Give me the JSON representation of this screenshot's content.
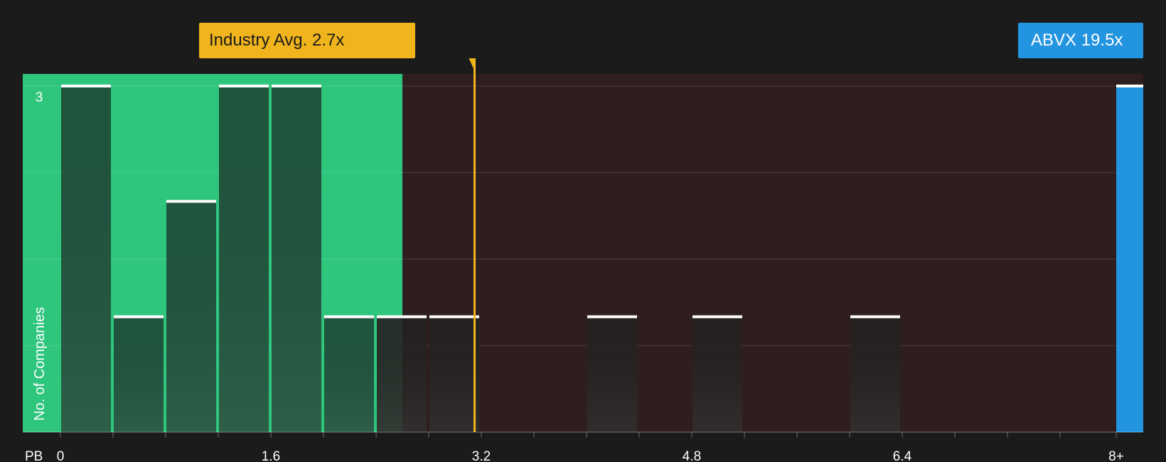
{
  "chart_data": {
    "type": "bar",
    "xlabel": "PB",
    "ylabel": "No. of Companies",
    "x_ticks": [
      "0",
      "1.6",
      "3.2",
      "4.8",
      "6.4",
      "8+"
    ],
    "y_tick_labels": [
      "3"
    ],
    "ylim": [
      0,
      3
    ],
    "bin_width": 0.4,
    "bins": [
      {
        "start": 0.0,
        "count": 3
      },
      {
        "start": 0.4,
        "count": 1
      },
      {
        "start": 0.8,
        "count": 2
      },
      {
        "start": 1.2,
        "count": 3
      },
      {
        "start": 1.6,
        "count": 3
      },
      {
        "start": 2.0,
        "count": 1
      },
      {
        "start": 2.4,
        "count": 1
      },
      {
        "start": 2.8,
        "count": 1
      },
      {
        "start": 4.0,
        "count": 1
      },
      {
        "start": 4.8,
        "count": 1
      },
      {
        "start": 6.0,
        "count": 1
      },
      {
        "start": 8.0,
        "count": 3,
        "label": "8+"
      }
    ],
    "industry_avg": {
      "label": "Industry Avg. 2.7x",
      "value": 2.7
    },
    "company": {
      "label": "ABVX 19.5x",
      "value": 19.5,
      "bin_label": "8+"
    },
    "fair_range_max": 2.6,
    "grid": true
  },
  "colors": {
    "background": "#1b1b1b",
    "fair_zone": "#2ec57d",
    "over_zone": "#2f1e1f",
    "bar_in_fair_zone": "#1e4a37",
    "bar_outside": "#262222",
    "industry": "#f0b41c",
    "company": "#2394e0",
    "bar_cap": "#ffffff"
  }
}
